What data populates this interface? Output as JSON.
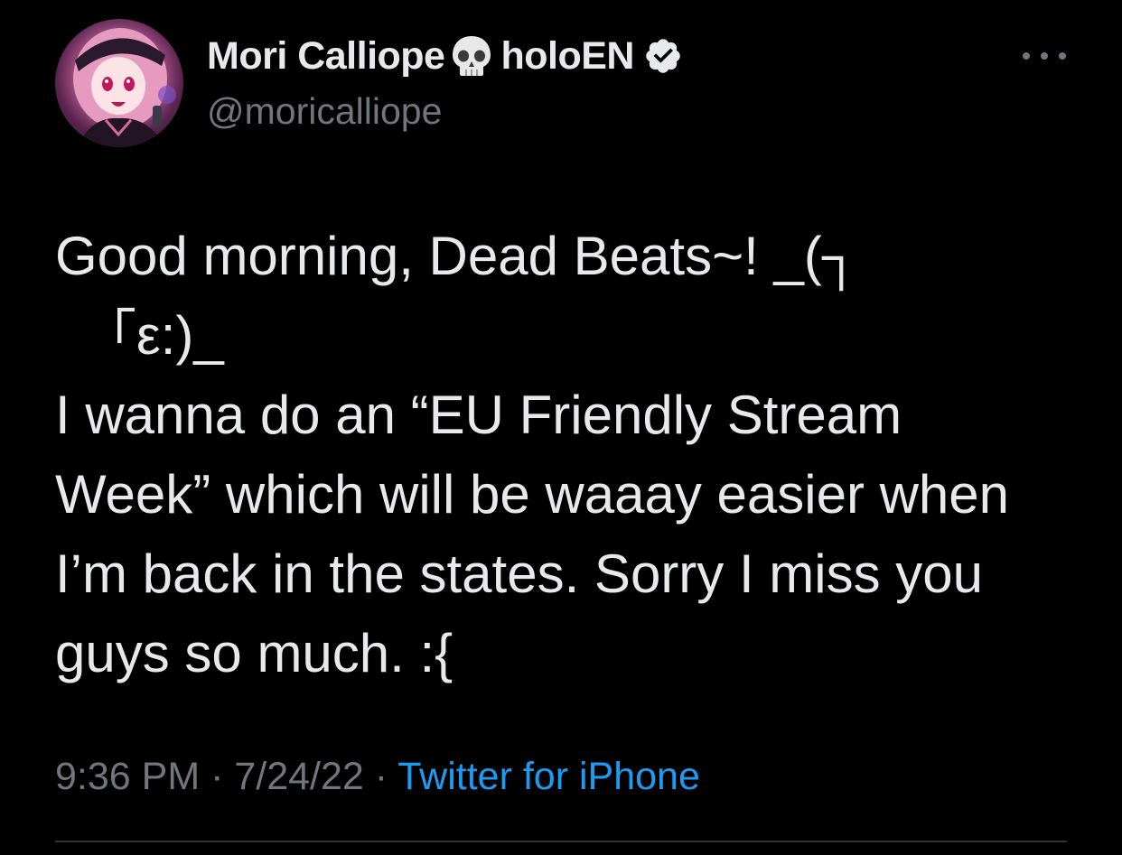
{
  "author": {
    "name": "Mori Calliope",
    "name_suffix": "holoEN",
    "handle": "@moricalliope",
    "verified": true,
    "avatar_icon": "avatar-image",
    "emoji_icon": "skull-icon"
  },
  "menu": {
    "icon": "more-options-icon"
  },
  "tweet": {
    "text": "Good morning, Dead Beats~! _(┐\n　「ε:)_\nI wanna do an “EU Friendly Stream Week” which will be waaay easier when I’m back in the states. Sorry I miss you guys so much. :{"
  },
  "meta": {
    "time": "9:36 PM",
    "separator_1": " · ",
    "date": "7/24/22",
    "separator_2": " · ",
    "source": "Twitter for iPhone"
  },
  "colors": {
    "background": "#000000",
    "text": "#e7e9ea",
    "secondary": "#71767b",
    "link": "#1d9bf0"
  }
}
